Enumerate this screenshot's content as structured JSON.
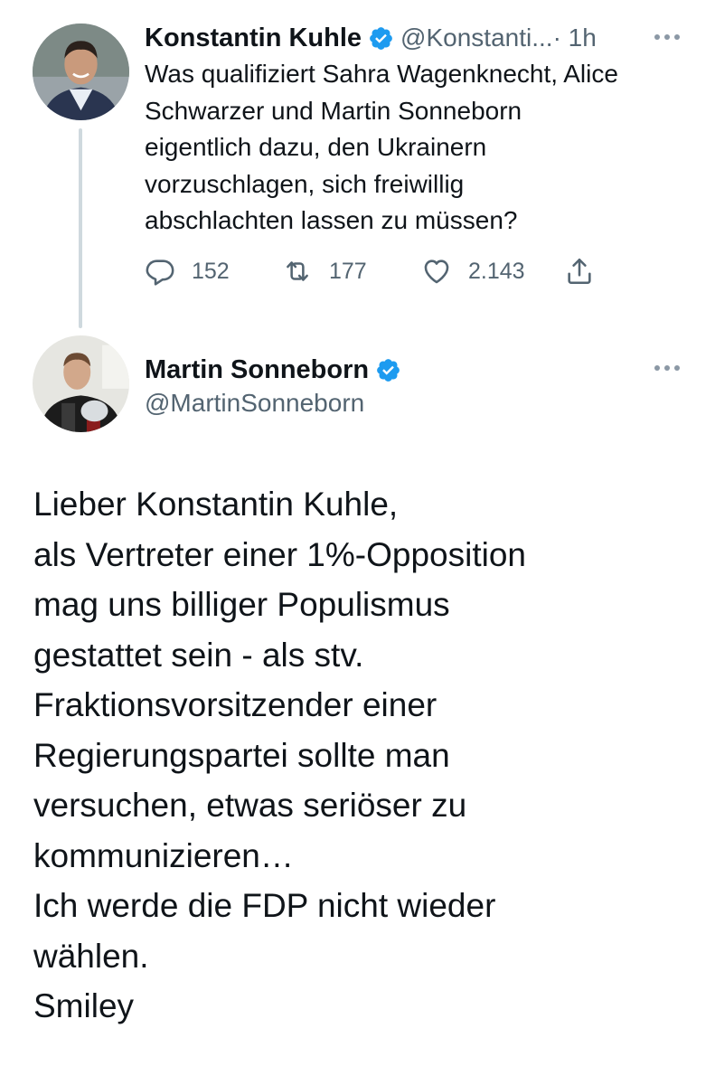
{
  "reply_tweet": {
    "author_name": "Konstantin Kuhle",
    "author_handle": "@Konstanti...",
    "time": " · 1h",
    "text": "Was qualifiziert Sahra Wagenknecht, Alice\nSchwarzer und Martin Sonneborn\neigentlich dazu, den Ukrainern\nvorzuschlagen, sich freiwillig\nabschlachten lassen zu müssen?",
    "replies": "152",
    "retweets": "177",
    "likes": "2.143"
  },
  "main_tweet": {
    "author_name": "Martin Sonneborn",
    "author_handle": "@MartinSonneborn",
    "text": "Lieber Konstantin Kuhle,\nals Vertreter einer 1%-Opposition\nmag uns billiger Populismus\ngestattet sein - als stv.\nFraktionsvorsitzender einer\nRegierungspartei sollte man\nversuchen, etwas seriöser zu\nkommunizieren…\nIch werde die FDP nicht wieder\nwählen.\nSmiley"
  },
  "icons": {
    "verified": "verified-badge-icon",
    "more": "more-options-icon",
    "reply": "reply-icon",
    "retweet": "retweet-icon",
    "like": "heart-icon",
    "share": "share-icon"
  },
  "colors": {
    "text": "#0f1419",
    "secondary": "#536471",
    "verified": "#1d9bf0",
    "thread_line": "#cfd9de"
  }
}
